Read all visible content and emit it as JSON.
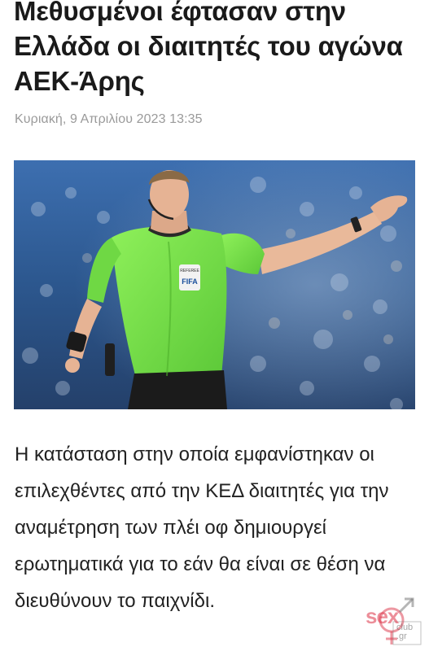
{
  "article": {
    "headline": "Μεθυσμένοι έφτασαν στην Ελλάδα οι διαιτητές του αγώνα ΑΕΚ-Άρης",
    "date": "Κυριακή, 9 Απριλίου 2023 13:35",
    "image": {
      "badge_top": "REFEREE",
      "badge_main": "FIFA"
    },
    "body": "Η κατάσταση στην οποία εμφανίστηκαν οι επιλεχθέντες από την ΚΕΔ διαιτητές για την αναμέτρηση των πλέι οφ δημιουργεί ερωτηματικά για το εάν θα είναι σε θέση να διευθύνουν το παιχνίδι."
  },
  "watermark": {
    "word": "sex",
    "sub_line1": "club",
    "sub_line2": ".gr",
    "icon": "venus-mars-icon"
  },
  "colors": {
    "headline": "#1a1a1a",
    "date": "#9a9a9a",
    "jersey": "#7ee04a",
    "watermark": "#dc3246"
  }
}
